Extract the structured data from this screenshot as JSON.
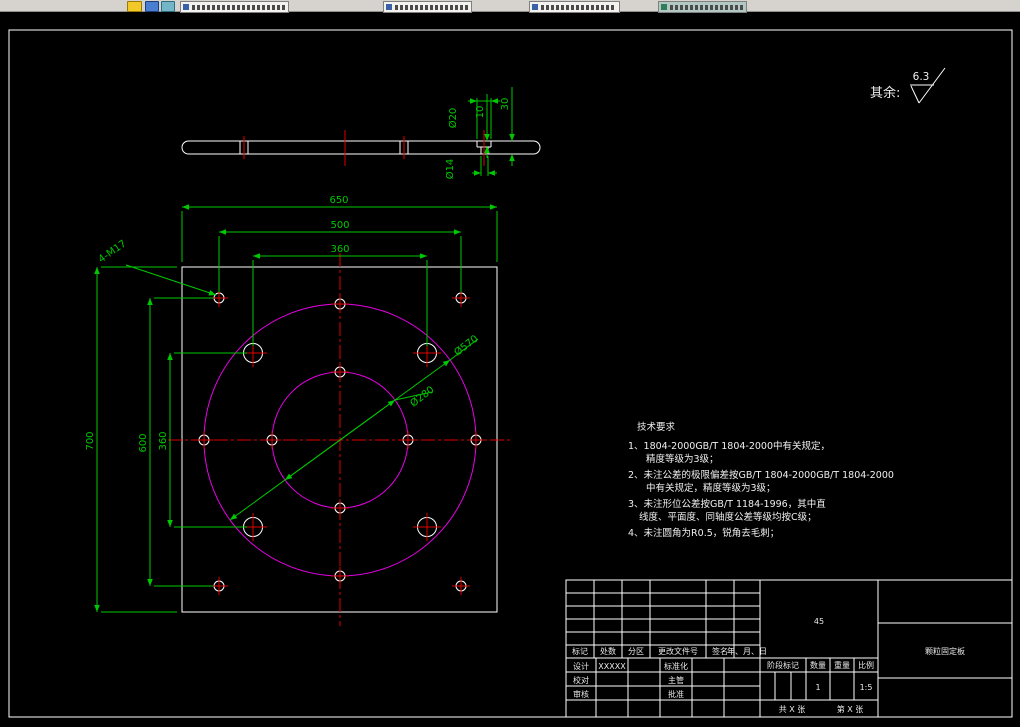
{
  "taskbar": {
    "tabs": [
      {
        "label": ""
      },
      {
        "label": ""
      },
      {
        "label": ""
      },
      {
        "label": ""
      }
    ]
  },
  "roughness": {
    "prefix": "其余:",
    "value": "6.3"
  },
  "side_dims": {
    "counterbore_dia": "Ø20",
    "counterbore_depth": "10",
    "thickness": "30",
    "hole_dia": "Ø14"
  },
  "front_dims": {
    "width": "650",
    "corner_hole_span_x": "500",
    "bolt_hole_span_x": "360",
    "height": "700",
    "corner_hole_span_y": "600",
    "bolt_hole_span_y": "360",
    "thread_note": "4-M17",
    "bolt_circle_dia": "Ø570",
    "inner_circle_dia": "Ø280"
  },
  "tech_requirements": {
    "title": "技术要求",
    "lines": [
      "1、1804-2000GB/T 1804-2000中有关规定，",
      "精度等级为3级；",
      "2、未注公差的极限偏差按GB/T 1804-2000GB/T 1804-2000",
      "中有关规定，精度等级为3级；",
      "3、未注形位公差按GB/T 1184-1996，其中直",
      "线度、平面度、同轴度公差等级均按C级；",
      "4、未注圆角为R0.5，锐角去毛刺；"
    ]
  },
  "title_block": {
    "material": "45",
    "part_name": "颗粒固定板",
    "rev_headers": [
      "标记",
      "处数",
      "分区",
      "更改文件号",
      "签名",
      "年、月、日"
    ],
    "roles": {
      "design": "设计",
      "check": "校对",
      "audit": "审核",
      "standardization": "标准化",
      "supervisor": "主管",
      "approve": "批准"
    },
    "designer_name": "XXXXX",
    "stage_headers": [
      "阶段标记",
      "数量",
      "重量",
      "比例"
    ],
    "quantity": "1",
    "scale": "1:5",
    "sheet_total": "共 X 张",
    "sheet_page": "第 X 张"
  },
  "colors": {
    "dimension": "#00c800",
    "centerline": "#e00000",
    "bolt_circle": "#e800e8",
    "object_line": "#ffffff"
  }
}
